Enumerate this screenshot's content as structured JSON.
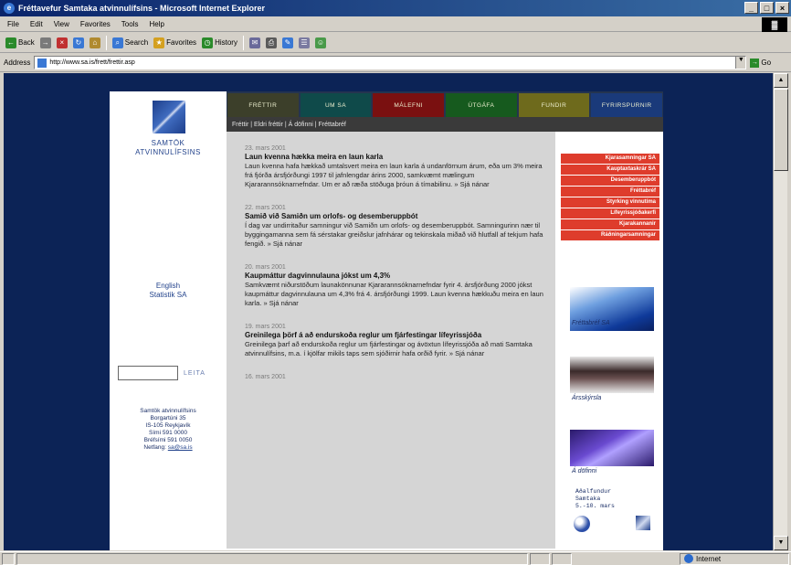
{
  "window": {
    "title": "Fréttavefur Samtaka atvinnulífsins - Microsoft Internet Explorer",
    "controls": [
      "_",
      "□",
      "×"
    ]
  },
  "menu": [
    "File",
    "Edit",
    "View",
    "Favorites",
    "Tools",
    "Help"
  ],
  "toolbar": {
    "back": "Back",
    "forward": "→",
    "search": "Search",
    "favorites": "Favorites",
    "history": "History"
  },
  "address": {
    "label": "Address",
    "url": "http://www.sa.is/frett/frettir.asp",
    "go": "Go"
  },
  "status": {
    "zone": "Internet"
  },
  "sidebar": {
    "logo_line1": "SAMTÖK",
    "logo_line2": "ATVINNULÍFSINS",
    "lang_english": "English",
    "lang_statistik": "Statistik SA",
    "search_button": "LEITA",
    "address_lines": [
      "Samtök atvinnulífsins",
      "Borgartúni 35",
      "IS-105 Reykjavík",
      "Sími 591 0000",
      "Bréfsími 591 0050"
    ],
    "email_label": "Netfang:",
    "email": "sa@sa.is"
  },
  "nav": {
    "tabs": [
      {
        "label": "FRÉTTIR",
        "color": "#3c3f2a"
      },
      {
        "label": "UM SA",
        "color": "#0f4a4a"
      },
      {
        "label": "MÁLEFNI",
        "color": "#7a1010"
      },
      {
        "label": "ÚTGÁFA",
        "color": "#165a1e"
      },
      {
        "label": "FUNDIR",
        "color": "#6e6a1c"
      },
      {
        "label": "FYRIRSPURNIR",
        "color": "#1a3a7a"
      }
    ],
    "subnav": "Fréttir | Eldri fréttir | Á döfinni | Fréttabréf"
  },
  "news": [
    {
      "date": "23. mars 2001",
      "headline": "Laun kvenna hækka meira en laun karla",
      "body": "Laun kvenna hafa hækkað umtalsvert meira en laun karla á undanförnum árum, eða um 3% meira frá fjórða ársfjórðungi 1997 til jafnlengdar árins 2000, samkvæmt mælingum Kjararannsóknarnefndar. Um er að ræða stöðuga þróun á tímabilinu.",
      "more": "» Sjá nánar"
    },
    {
      "date": "22. mars 2001",
      "headline": "Samið við Samiðn um orlofs- og desemberuppbót",
      "body": "Í dag var undirritaður samningur við Samiðn um orlofs- og desemberuppbót. Samningurinn nær til byggingamanna sem fá sérstakar greiðslur jafnhárar og tekinskala miðað við hlutfall af tekjum hafa fengið.",
      "more": "» Sjá nánar"
    },
    {
      "date": "20. mars 2001",
      "headline": "Kaupmáttur dagvinnulauna jókst um 4,3%",
      "body": "Samkvæmt niðurstöðum launakönnunar Kjararannsóknarnefndar fyrir 4. ársfjórðung 2000 jókst kaupmáttur dagvinnulauna um 4,3% frá 4. ársfjórðungi 1999. Laun kvenna hækkuðu meira en laun karla.",
      "more": "» Sjá nánar"
    },
    {
      "date": "19. mars 2001",
      "headline": "Greinilega þörf á að endurskoða reglur um fjárfestingar lífeyrissjóða",
      "body": "Greinilega þarf að endurskoða reglur um fjárfestingar og ávöxtun lífeyrissjóða að mati Samtaka atvinnulífsins, m.a. í kjölfar mikils taps sem sjóðirnir hafa orðið fyrir.",
      "more": "» Sjá nánar"
    }
  ],
  "news_next_date": "16. mars 2001",
  "rightbar": {
    "links": [
      "Kjarasamningar SA",
      "Kauptaxtaskrár SA",
      "Desemberuppbót",
      "Fréttabréf",
      "Styrking vinnutíma",
      "Lífeyrissjóðakerfi",
      "Kjarakannanir",
      "Ráðningarsamningar"
    ],
    "img1_caption": "Fréttabréf SA",
    "img2_caption": "Ársskýrsla",
    "img3_caption": "Á döfinni",
    "event_lines": [
      "Aðalfundur",
      "Samtaka",
      "5.-10. mars"
    ]
  }
}
